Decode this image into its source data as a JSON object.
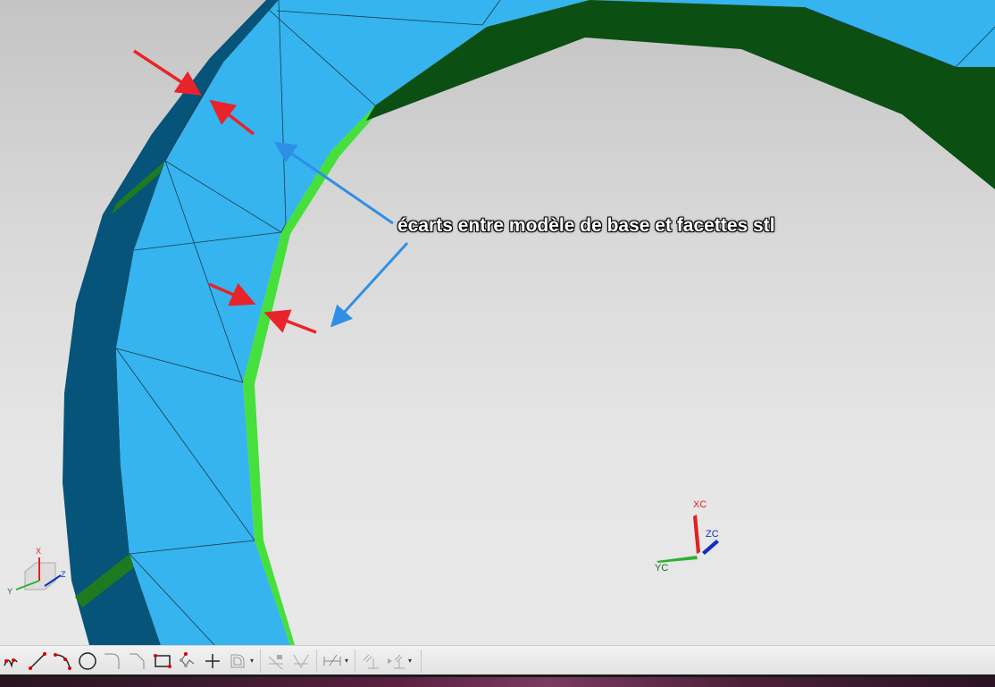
{
  "annotation": {
    "text": "écarts  entre modèle de base et facettes stl"
  },
  "triad_main": {
    "x": "XC",
    "y": "YC",
    "z": "ZC"
  },
  "triad_corner": {
    "x": "X",
    "y": "Y",
    "z": "Z"
  },
  "colors": {
    "face": "#35b4ef",
    "outer_edge": "#065479",
    "inner_edge": "#45e03c",
    "dark_band": "#0b4f12",
    "arrow_red": "#e8242a",
    "arrow_blue": "#2f8fe6"
  },
  "toolbar": {
    "tools": [
      "studio-spline",
      "line",
      "arc",
      "circle",
      "fillet",
      "chamfer",
      "rectangle",
      "polygon",
      "point",
      "offset-curve",
      "trim",
      "extend",
      "dimension",
      "constraint",
      "display-constraints"
    ]
  }
}
